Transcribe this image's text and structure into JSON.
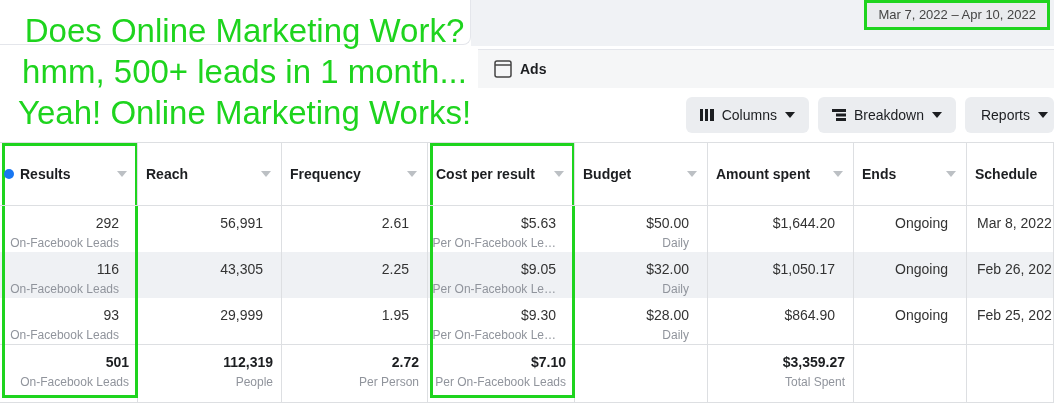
{
  "annotation": {
    "lines": [
      "Does Online Marketing Work?",
      "hmm, 500+ leads in 1 month...",
      "Yeah! Online Marketing Works!"
    ]
  },
  "date_range": {
    "label": "Mar 7, 2022 – Apr 10, 2022",
    "highlighted": true
  },
  "view_title": "Ads",
  "toolbar": [
    {
      "label": "Columns",
      "kind": "columns"
    },
    {
      "label": "Breakdown",
      "kind": "breakdown"
    },
    {
      "label": "Reports",
      "kind": "plain"
    }
  ],
  "table": {
    "columns": [
      {
        "label": "Results",
        "sortable": true,
        "info": true,
        "highlighted": true,
        "kind": "number"
      },
      {
        "label": "Reach",
        "sortable": true,
        "info": false,
        "highlighted": false,
        "kind": "number"
      },
      {
        "label": "Frequency",
        "sortable": true,
        "info": false,
        "highlighted": false,
        "kind": "number"
      },
      {
        "label": "Cost per result",
        "sortable": true,
        "info": false,
        "highlighted": true,
        "kind": "number"
      },
      {
        "label": "Budget",
        "sortable": true,
        "info": false,
        "highlighted": false,
        "kind": "number"
      },
      {
        "label": "Amount spent",
        "sortable": true,
        "info": false,
        "highlighted": false,
        "kind": "number"
      },
      {
        "label": "Ends",
        "sortable": true,
        "info": false,
        "highlighted": false,
        "kind": "number"
      },
      {
        "label": "Schedule",
        "sortable": false,
        "info": false,
        "highlighted": false,
        "kind": "date"
      }
    ],
    "rows": [
      {
        "kind": "row",
        "hovered": false,
        "cells": [
          {
            "value": "292",
            "sub": "On-Facebook Leads"
          },
          {
            "value": "56,991"
          },
          {
            "value": "2.61"
          },
          {
            "value": "$5.63",
            "sub": "Per On-Facebook Le…"
          },
          {
            "value": "$50.00",
            "sub": "Daily"
          },
          {
            "value": "$1,644.20"
          },
          {
            "value": "Ongoing"
          },
          {
            "value": "Mar 8, 2022"
          }
        ]
      },
      {
        "kind": "row",
        "hovered": true,
        "cells": [
          {
            "value": "116",
            "sub": "On-Facebook Leads"
          },
          {
            "value": "43,305"
          },
          {
            "value": "2.25"
          },
          {
            "value": "$9.05",
            "sub": "Per On-Facebook Le…"
          },
          {
            "value": "$32.00",
            "sub": "Daily"
          },
          {
            "value": "$1,050.17"
          },
          {
            "value": "Ongoing"
          },
          {
            "value": "Feb 26, 202"
          }
        ]
      },
      {
        "kind": "row",
        "hovered": false,
        "cells": [
          {
            "value": "93",
            "sub": "On-Facebook Leads"
          },
          {
            "value": "29,999"
          },
          {
            "value": "1.95"
          },
          {
            "value": "$9.30",
            "sub": "Per On-Facebook Le…"
          },
          {
            "value": "$28.00",
            "sub": "Daily"
          },
          {
            "value": "$864.90"
          },
          {
            "value": "Ongoing"
          },
          {
            "value": "Feb 25, 202"
          }
        ]
      },
      {
        "kind": "total",
        "hovered": false,
        "cells": [
          {
            "value": "501",
            "sub": "On-Facebook Leads"
          },
          {
            "value": "112,319",
            "sub": "People"
          },
          {
            "value": "2.72",
            "sub": "Per Person"
          },
          {
            "value": "$7.10",
            "sub": "Per On-Facebook Leads"
          },
          null,
          {
            "value": "$3,359.27",
            "sub": "Total Spent"
          },
          null,
          null
        ]
      }
    ]
  }
}
